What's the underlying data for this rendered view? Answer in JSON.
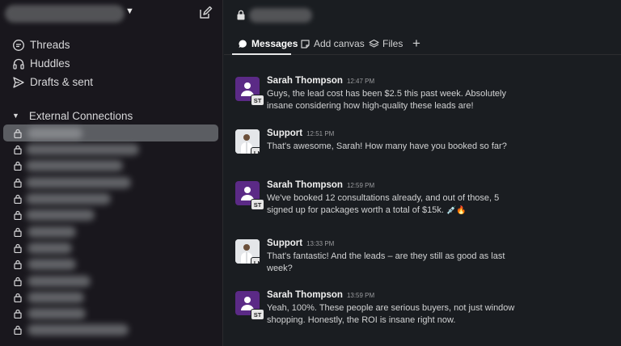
{
  "sidebar": {
    "items": [
      {
        "label": "Threads",
        "icon": "threads-icon"
      },
      {
        "label": "Huddles",
        "icon": "headphones-icon"
      },
      {
        "label": "Drafts & sent",
        "icon": "send-icon"
      }
    ],
    "section_label": "External Connections"
  },
  "tabs": [
    {
      "label": "Messages",
      "icon": "chat-bubble-icon"
    },
    {
      "label": "Add canvas",
      "icon": "canvas-icon"
    },
    {
      "label": "Files",
      "icon": "layers-icon"
    }
  ],
  "messages": [
    {
      "sender": "Sarah Thompson",
      "time": "12:47 PM",
      "initials": "ST",
      "text": "Guys, the lead cost has been $2.5 this past week. Absolutely insane considering how high-quality these leads are!"
    },
    {
      "sender": "Support",
      "time": "12:51 PM",
      "initials": "LL",
      "text": "That's awesome, Sarah! How many have you booked so far?"
    },
    {
      "sender": "Sarah Thompson",
      "time": "12:59 PM",
      "initials": "ST",
      "text": "We've booked 12 consultations already, and out of those, 5 signed up for packages worth a total of $15k.",
      "emoji": "💉🔥"
    },
    {
      "sender": "Support",
      "time": "13:33 PM",
      "initials": "LL",
      "text": "That's fantastic! And the leads – are they still as good as last week?"
    },
    {
      "sender": "Sarah Thompson",
      "time": "13:59 PM",
      "initials": "ST",
      "text": "Yeah, 100%. These people are serious buyers, not just window shopping. Honestly, the ROI is insane right now."
    }
  ],
  "colors": {
    "sidebar_bg": "#19171d",
    "main_bg": "#1a1d21",
    "avatar_purple": "#5b2a86"
  }
}
